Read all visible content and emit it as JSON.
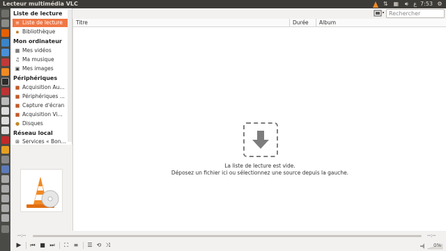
{
  "app": {
    "title": "Lecteur multimédia VLC",
    "tray_time": "7:53",
    "tray_lang": "ع",
    "search_placeholder": "Rechercher"
  },
  "sidebar": {
    "sections": [
      {
        "heading": "Liste de lecture",
        "items": [
          {
            "label": "Liste de lecture",
            "icon": "playlist-icon",
            "selected": true
          },
          {
            "label": "Bibliothèque",
            "icon": "library-icon",
            "selected": false
          }
        ]
      },
      {
        "heading": "Mon ordinateur",
        "items": [
          {
            "label": "Mes vidéos",
            "icon": "video-icon",
            "selected": false
          },
          {
            "label": "Ma musique",
            "icon": "music-icon",
            "selected": false
          },
          {
            "label": "Mes images",
            "icon": "image-icon",
            "selected": false
          }
        ]
      },
      {
        "heading": "Périphériques",
        "items": [
          {
            "label": "Acquisition Au...",
            "icon": "audio-capture-icon",
            "selected": false
          },
          {
            "label": "Périphériques ...",
            "icon": "device-icon",
            "selected": false
          },
          {
            "label": "Capture d'écran",
            "icon": "screen-capture-icon",
            "selected": false
          },
          {
            "label": "Acquisition Vi...",
            "icon": "video-capture-icon",
            "selected": false
          },
          {
            "label": "Disques",
            "icon": "disc-icon",
            "selected": false
          }
        ]
      },
      {
        "heading": "Réseau local",
        "items": [
          {
            "label": "Services « Bon...",
            "icon": "network-icon",
            "selected": false
          }
        ]
      }
    ]
  },
  "playlist": {
    "columns": [
      "Titre",
      "Durée",
      "Album"
    ],
    "empty_line1": "La liste de lecture est vide.",
    "empty_line2": "Déposez un fichier ici ou sélectionnez une source depuis la gauche."
  },
  "player": {
    "elapsed": "--:--",
    "remaining": "--:--",
    "volume": "0%"
  },
  "colors": {
    "accent": "#f07746",
    "topbar": "#3c3b37",
    "launcher": "#4a4a46"
  }
}
